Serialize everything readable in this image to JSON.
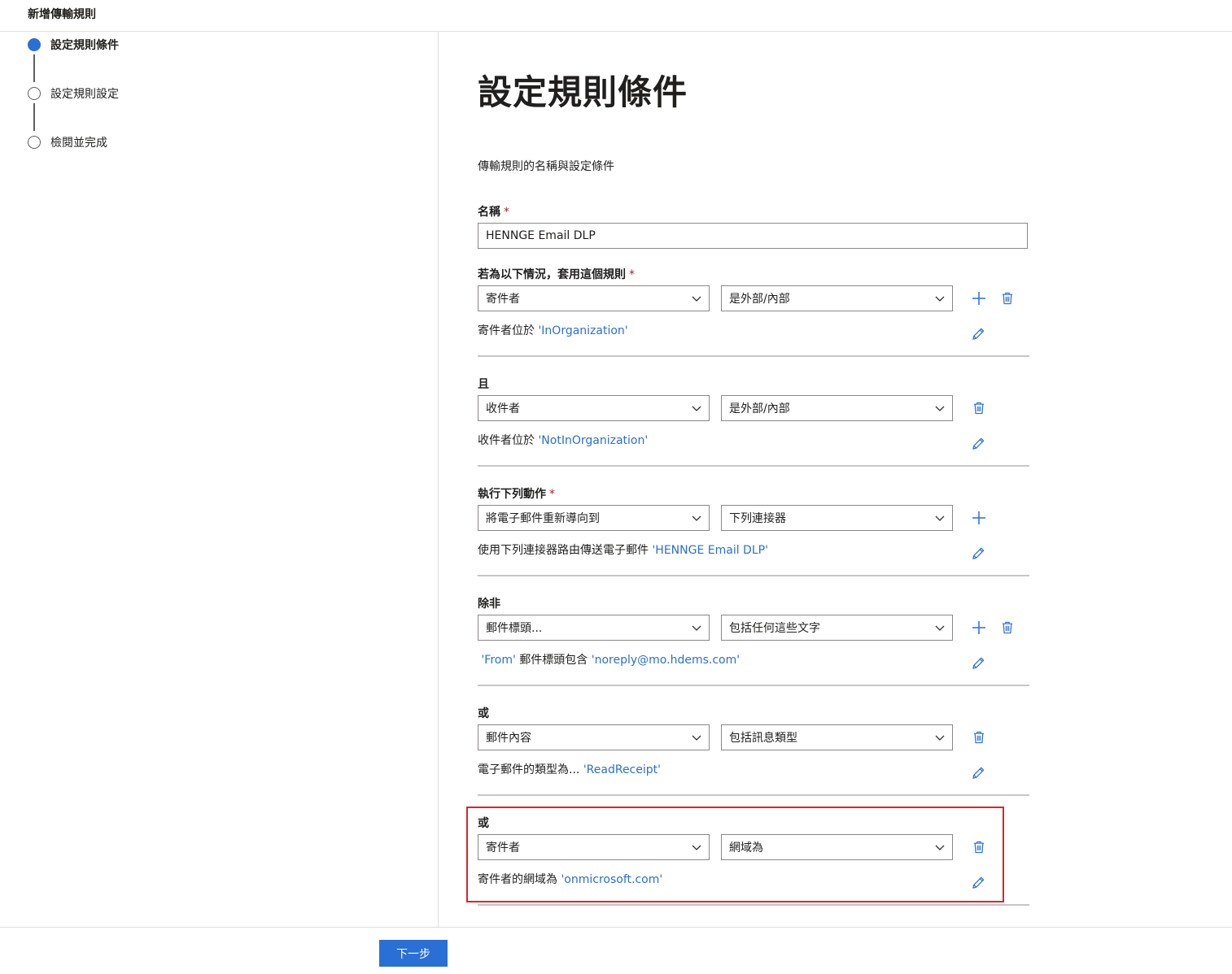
{
  "header": {
    "title": "新增傳輸規則"
  },
  "steps": [
    {
      "label": "設定規則條件",
      "active": true
    },
    {
      "label": "設定規則設定",
      "active": false
    },
    {
      "label": "檢閱並完成",
      "active": false
    }
  ],
  "main": {
    "title": "設定規則條件",
    "subtitle": "傳輸規則的名稱與設定條件",
    "name_label": "名稱",
    "required_mark": "*",
    "name_value": "HENNGE Email DLP"
  },
  "rules": [
    {
      "label": "若為以下情況，套用這個規則",
      "required": true,
      "dropdown1": "寄件者",
      "dropdown2": "是外部/內部",
      "desc_prefix": "寄件者位於 ",
      "desc_value": "'InOrganization'",
      "desc_suffix": "",
      "desc_value2": "",
      "has_add": true,
      "has_delete": true
    },
    {
      "label": "且",
      "required": false,
      "dropdown1": "收件者",
      "dropdown2": "是外部/內部",
      "desc_prefix": "收件者位於 ",
      "desc_value": "'NotInOrganization'",
      "desc_suffix": "",
      "desc_value2": "",
      "has_add": false,
      "has_delete": true
    },
    {
      "label": "執行下列動作",
      "required": true,
      "dropdown1": "將電子郵件重新導向到",
      "dropdown2": "下列連接器",
      "desc_prefix": "使用下列連接器路由傳送電子郵件 ",
      "desc_value": "'HENNGE Email DLP'",
      "desc_suffix": "",
      "desc_value2": "",
      "has_add": true,
      "has_delete": false
    },
    {
      "label": "除非",
      "required": false,
      "dropdown1": "郵件標頭...",
      "dropdown2": "包括任何這些文字",
      "desc_prefix": " ",
      "desc_value": "'From'",
      "desc_suffix": " 郵件標頭包含 ",
      "desc_value2": "'noreply@mo.hdems.com'",
      "has_add": true,
      "has_delete": true
    },
    {
      "label": "或",
      "required": false,
      "dropdown1": "郵件內容",
      "dropdown2": "包括訊息類型",
      "desc_prefix": "電子郵件的類型為... ",
      "desc_value": "'ReadReceipt'",
      "desc_suffix": "",
      "desc_value2": "",
      "has_add": false,
      "has_delete": true
    },
    {
      "label": "或",
      "required": false,
      "dropdown1": "寄件者",
      "dropdown2": "網域為",
      "desc_prefix": "寄件者的網域為 ",
      "desc_value": "'onmicrosoft.com'",
      "desc_suffix": "",
      "desc_value2": "",
      "has_add": false,
      "has_delete": true
    }
  ],
  "footer": {
    "next_label": "下一步"
  },
  "colors": {
    "accent": "#2a6fd6",
    "highlight": "#e02424",
    "required": "#a4262c"
  },
  "icons": {
    "add": "add-icon",
    "delete": "trash-icon",
    "edit": "pencil-icon",
    "dropdown": "chevron-down-icon"
  }
}
